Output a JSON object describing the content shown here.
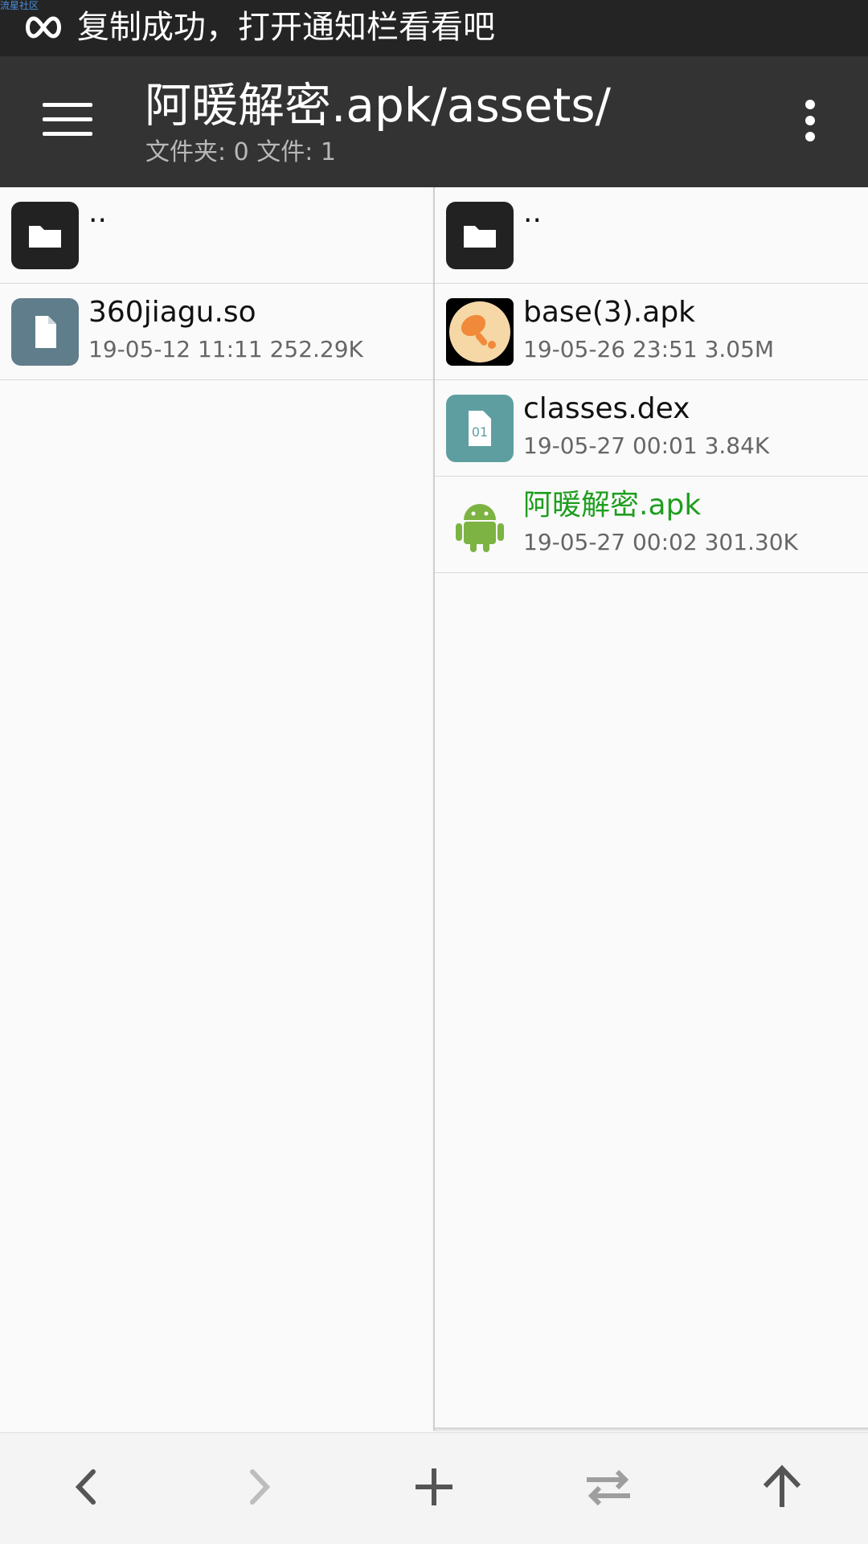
{
  "watermark": "流星社区",
  "notification": {
    "icon": "infinity-icon",
    "text": "复制成功，打开通知栏看看吧"
  },
  "appbar": {
    "title": "阿暖解密.apk/assets/",
    "subtitle": "文件夹: 0  文件: 1",
    "menu_icon": "hamburger-menu-icon",
    "more_icon": "more-vertical-icon"
  },
  "left_pane": {
    "items": [
      {
        "name": "..",
        "meta": "",
        "icon": "folder-icon"
      },
      {
        "name": "360jiagu.so",
        "meta": "19-05-12 11:11  252.29K",
        "icon": "file-icon"
      }
    ]
  },
  "right_pane": {
    "items": [
      {
        "name": "..",
        "meta": "",
        "icon": "folder-icon"
      },
      {
        "name": "base(3).apk",
        "meta": "19-05-26 23:51  3.05M",
        "icon": "app-drumstick-icon"
      },
      {
        "name": "classes.dex",
        "meta": "19-05-27 00:01  3.84K",
        "icon": "dex-file-icon"
      },
      {
        "name": "阿暖解密.apk",
        "meta": "19-05-27 00:02  301.30K",
        "icon": "android-icon"
      }
    ]
  },
  "bottom_bar": {
    "buttons": [
      "back-icon",
      "forward-icon",
      "add-icon",
      "swap-icon",
      "up-icon"
    ]
  },
  "colors": {
    "statusbar": "#242424",
    "appbar": "#333333",
    "folder_icon_bg": "#222222",
    "file_icon_bg": "#607d8b",
    "dex_icon_bg": "#5f9ea0",
    "apk_name_green": "#1e9e1e",
    "base_icon_bg": "#f6d7a6"
  }
}
